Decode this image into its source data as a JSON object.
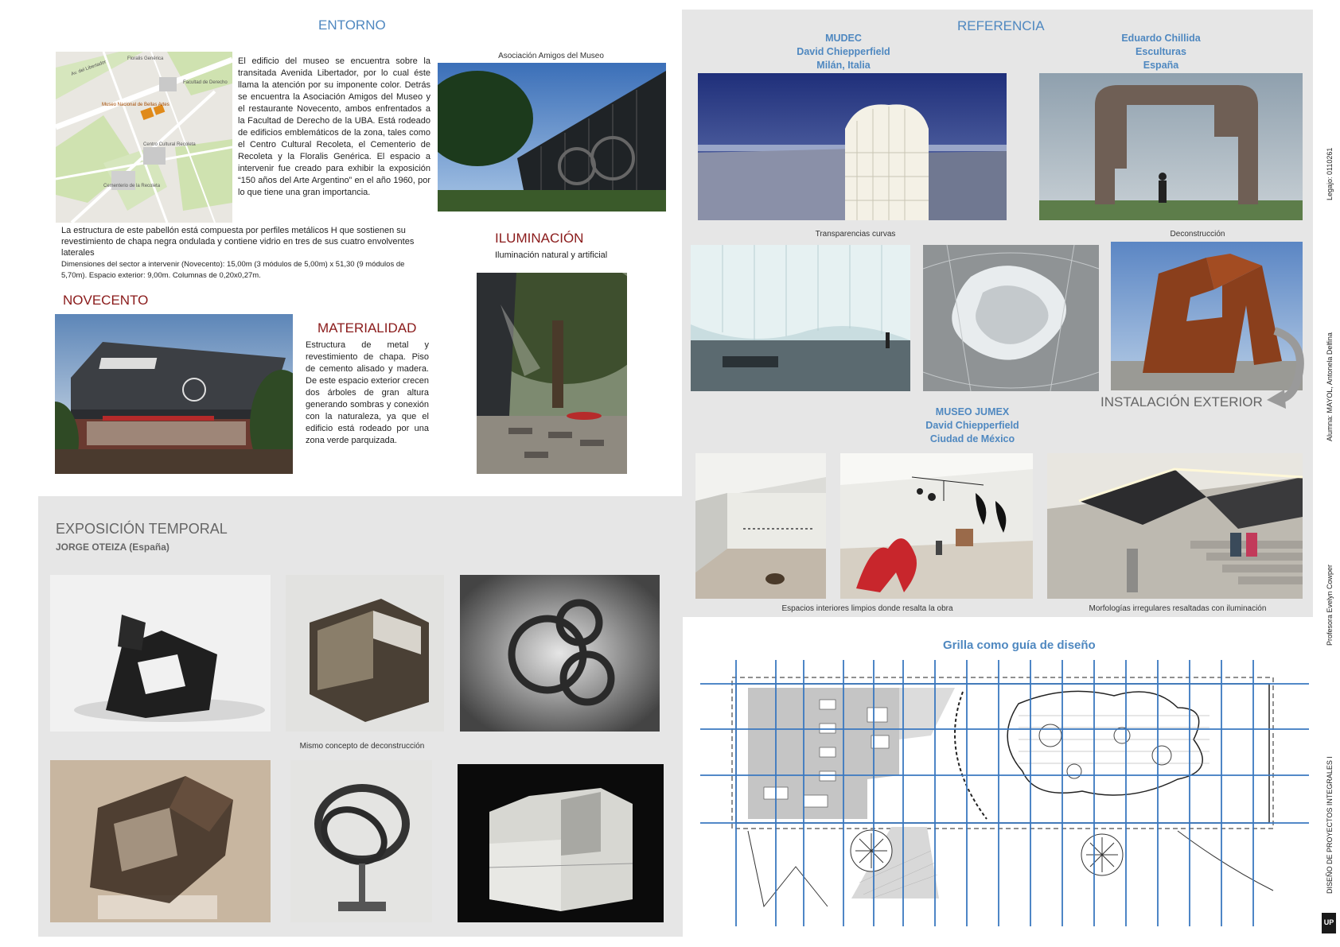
{
  "entorno": {
    "title": "ENTORNO",
    "map_labels": {
      "floralis": "Floralis Genérica",
      "facultad": "Facultad de Derecho",
      "museo": "Museo Nacional de Bellas Artes",
      "recoleta": "Centro Cultural Recoleta",
      "cementerio": "Cementerio de la Recoleta",
      "libertador": "Av. del Libertador"
    },
    "paragraph": "El edificio del museo se encuentra sobre la transitada Avenida Libertador, por lo cual éste llama la atención por su imponente color. Detrás se encuentra la Asociación Amigos del Museo y el restaurante Novecento, ambos enfrentados a la Facultad de Derecho de la UBA. Está rodeado de edificios emblemáticos de la zona, tales como el Centro Cultural Recoleta, el Cementerio de Recoleta y la Floralis Genérica. El espacio a intervenir fue creado para exhibir la exposición “150 años del Arte Argentino” en el año 1960, por lo que tiene una gran importancia.",
    "photo_caption": "Asociación Amigos del Museo",
    "structure_text": "La estructura de este pabellón está compuesta por perfiles metálicos H que sostienen su revestimiento de chapa negra ondulada y contiene vidrio en tres de sus cuatro envolventes laterales",
    "dimensions_text": "Dimensiones del sector a intervenir (Novecento): 15,00m (3 módulos de 5,00m) x 51,30 (9 módulos de 5,70m). Espacio exterior: 9,00m. Columnas de 0,20x0,27m."
  },
  "novecento": {
    "title": "NOVECENTO"
  },
  "materialidad": {
    "title": "MATERIALIDAD",
    "text": "Estructura de metal y revestimiento de chapa. Piso de cemento alisado y madera. De este espacio exterior crecen dos árboles de gran altura generando sombras y conexión con la naturaleza, ya que el edificio está rodeado por una zona verde parquizada."
  },
  "iluminacion": {
    "title": "ILUMINACIÓN",
    "subtitle": "Iluminación natural y artificial"
  },
  "referencia": {
    "title": "REFERENCIA",
    "mudec": {
      "line1": "MUDEC",
      "line2": "David Chiepperfield",
      "line3": "Milán, Italia",
      "caption": "Transparencias curvas"
    },
    "chillida": {
      "line1": "Eduardo Chillida",
      "line2": "Esculturas",
      "line3": "España",
      "caption": "Deconstrucción"
    },
    "instalacion": "INSTALACIÓN EXTERIOR",
    "jumex": {
      "line1": "MUSEO JUMEX",
      "line2": "David Chiepperfield",
      "line3": "Ciudad de México",
      "caption_left": "Espacios interiores limpios donde resalta la obra",
      "caption_right": "Morfologías irregulares resaltadas con iluminación"
    }
  },
  "exposicion": {
    "title": "EXPOSICIÓN TEMPORAL",
    "subtitle": "JORGE OTEIZA (España)",
    "caption": "Mismo concepto de deconstrucción"
  },
  "grilla": {
    "title": "Grilla como guía de diseño"
  },
  "sidebar": {
    "legajo": "Legajo: 0110261",
    "alumna": "Alumna: MAYOL, Antonela Delfina",
    "profesora": "Profesora Evelyn Cowper",
    "materia": "DISEÑO DE PROYECTOS INTEGRALES I",
    "logo": "UP"
  },
  "colors": {
    "blue_accent": "#4f88c0",
    "red_accent": "#8a1a1a",
    "panel_gray": "#e6e6e6",
    "grid_blue": "#3a78c0"
  }
}
